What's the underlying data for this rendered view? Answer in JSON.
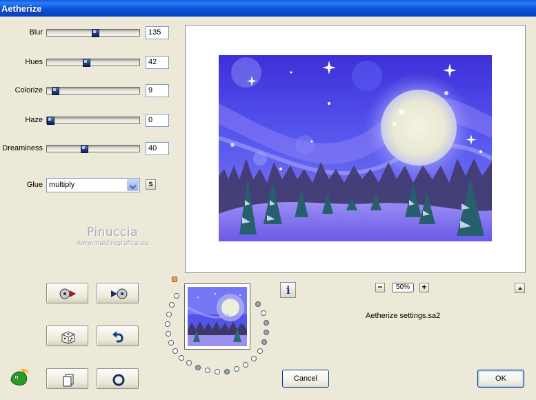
{
  "window": {
    "title": "Aetherize"
  },
  "sliders": [
    {
      "label": "Blur",
      "value": "135",
      "level": 0.53
    },
    {
      "label": "Hues",
      "value": "42",
      "level": 0.42
    },
    {
      "label": "Colorize",
      "value": "9",
      "level": 0.06
    },
    {
      "label": "Haze",
      "value": "0",
      "level": 0.0
    },
    {
      "label": "Dreaminess",
      "value": "40",
      "level": 0.4
    }
  ],
  "glue": {
    "label": "Glue",
    "value": "multiply",
    "save_label": "S"
  },
  "watermark": {
    "name": "Pinuccia",
    "url": "www.maidiregrafica.eu"
  },
  "preview": {
    "zoom": "50%",
    "zoom_minus": "−",
    "zoom_plus": "+"
  },
  "toolbar": {
    "icons": [
      "rewind-reel-icon",
      "forward-reel-icon",
      "dice-icon",
      "undo-icon",
      "copy-icon",
      "reset-circle-icon"
    ]
  },
  "info_label": "i",
  "settings_file": "Aetherize settings.sa2",
  "buttons": {
    "cancel": "Cancel",
    "ok": "OK"
  },
  "colors": {
    "title_bar": "#0a56dc",
    "dialog_bg": "#ece9d8",
    "thumb_handle": "#1d3d7a"
  }
}
